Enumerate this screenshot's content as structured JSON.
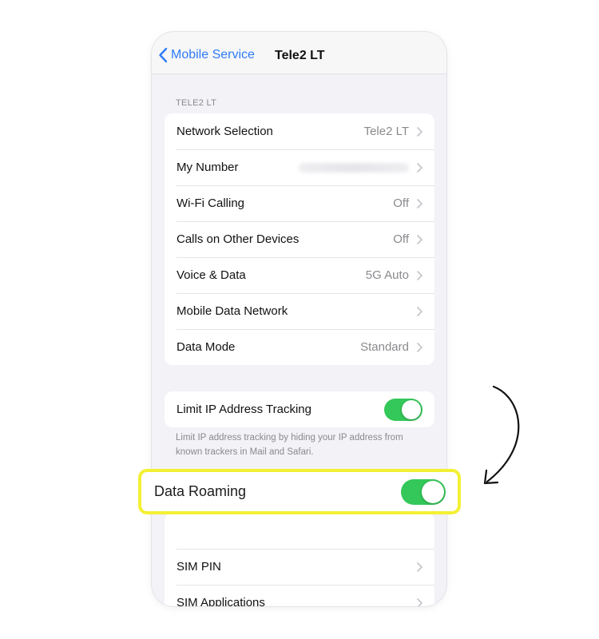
{
  "navbar": {
    "back_label": "Mobile Service",
    "title": "Tele2 LT"
  },
  "carrier_section": {
    "header": "TELE2 LT",
    "rows": [
      {
        "label": "Network Selection",
        "value": "Tele2 LT"
      },
      {
        "label": "My Number",
        "value": ""
      },
      {
        "label": "Wi-Fi Calling",
        "value": "Off"
      },
      {
        "label": "Calls on Other Devices",
        "value": "Off"
      },
      {
        "label": "Voice & Data",
        "value": "5G Auto"
      },
      {
        "label": "Mobile Data Network",
        "value": ""
      },
      {
        "label": "Data Mode",
        "value": "Standard"
      }
    ]
  },
  "privacy_section": {
    "limit_ip_label": "Limit IP Address Tracking",
    "limit_ip_on": true,
    "footnote": "Limit IP address tracking by hiding your IP address from known trackers in Mail and Safari."
  },
  "roaming": {
    "label": "Data Roaming",
    "on": true
  },
  "sim_section": {
    "rows": [
      {
        "label": "SIM PIN"
      },
      {
        "label": "SIM Applications"
      }
    ]
  },
  "colors": {
    "accent": "#2e7cf6",
    "toggle_on": "#34c759",
    "highlight": "#f3f033"
  }
}
